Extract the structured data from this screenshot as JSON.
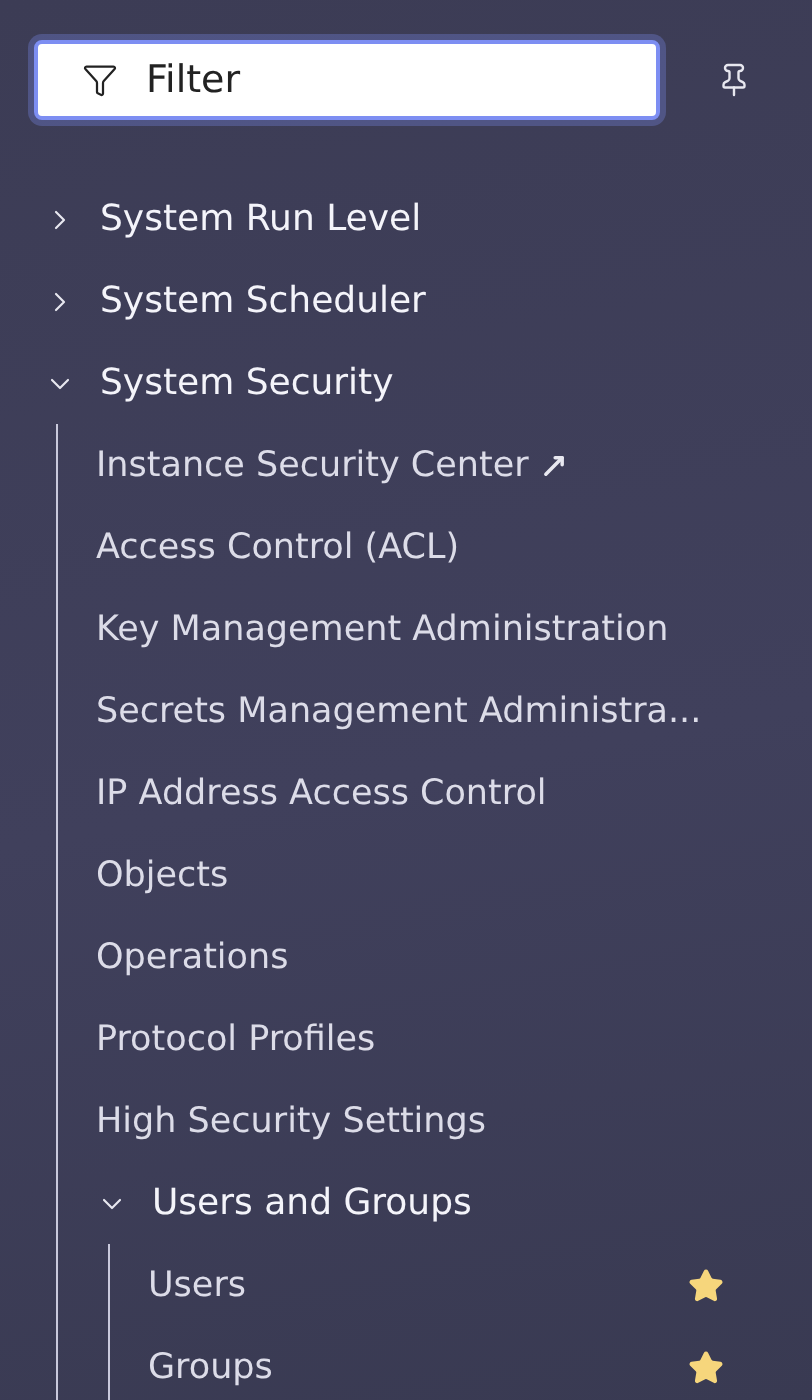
{
  "filter": {
    "placeholder": "Filter"
  },
  "tree": [
    {
      "label": "System Run Level",
      "expanded": false
    },
    {
      "label": "System Scheduler",
      "expanded": false
    },
    {
      "label": "System Security",
      "expanded": true,
      "children": [
        {
          "label": "Instance Security Center",
          "external": true
        },
        {
          "label": "Access Control (ACL)"
        },
        {
          "label": "Key Management Administration"
        },
        {
          "label": "Secrets Management Administra..."
        },
        {
          "label": "IP Address Access Control"
        },
        {
          "label": "Objects"
        },
        {
          "label": "Operations"
        },
        {
          "label": "Protocol Profiles"
        },
        {
          "label": "High Security Settings"
        },
        {
          "label": "Users and Groups",
          "expanded": true,
          "children": [
            {
              "label": "Users",
              "favorite": true
            },
            {
              "label": "Groups",
              "favorite": true
            }
          ]
        }
      ]
    }
  ]
}
